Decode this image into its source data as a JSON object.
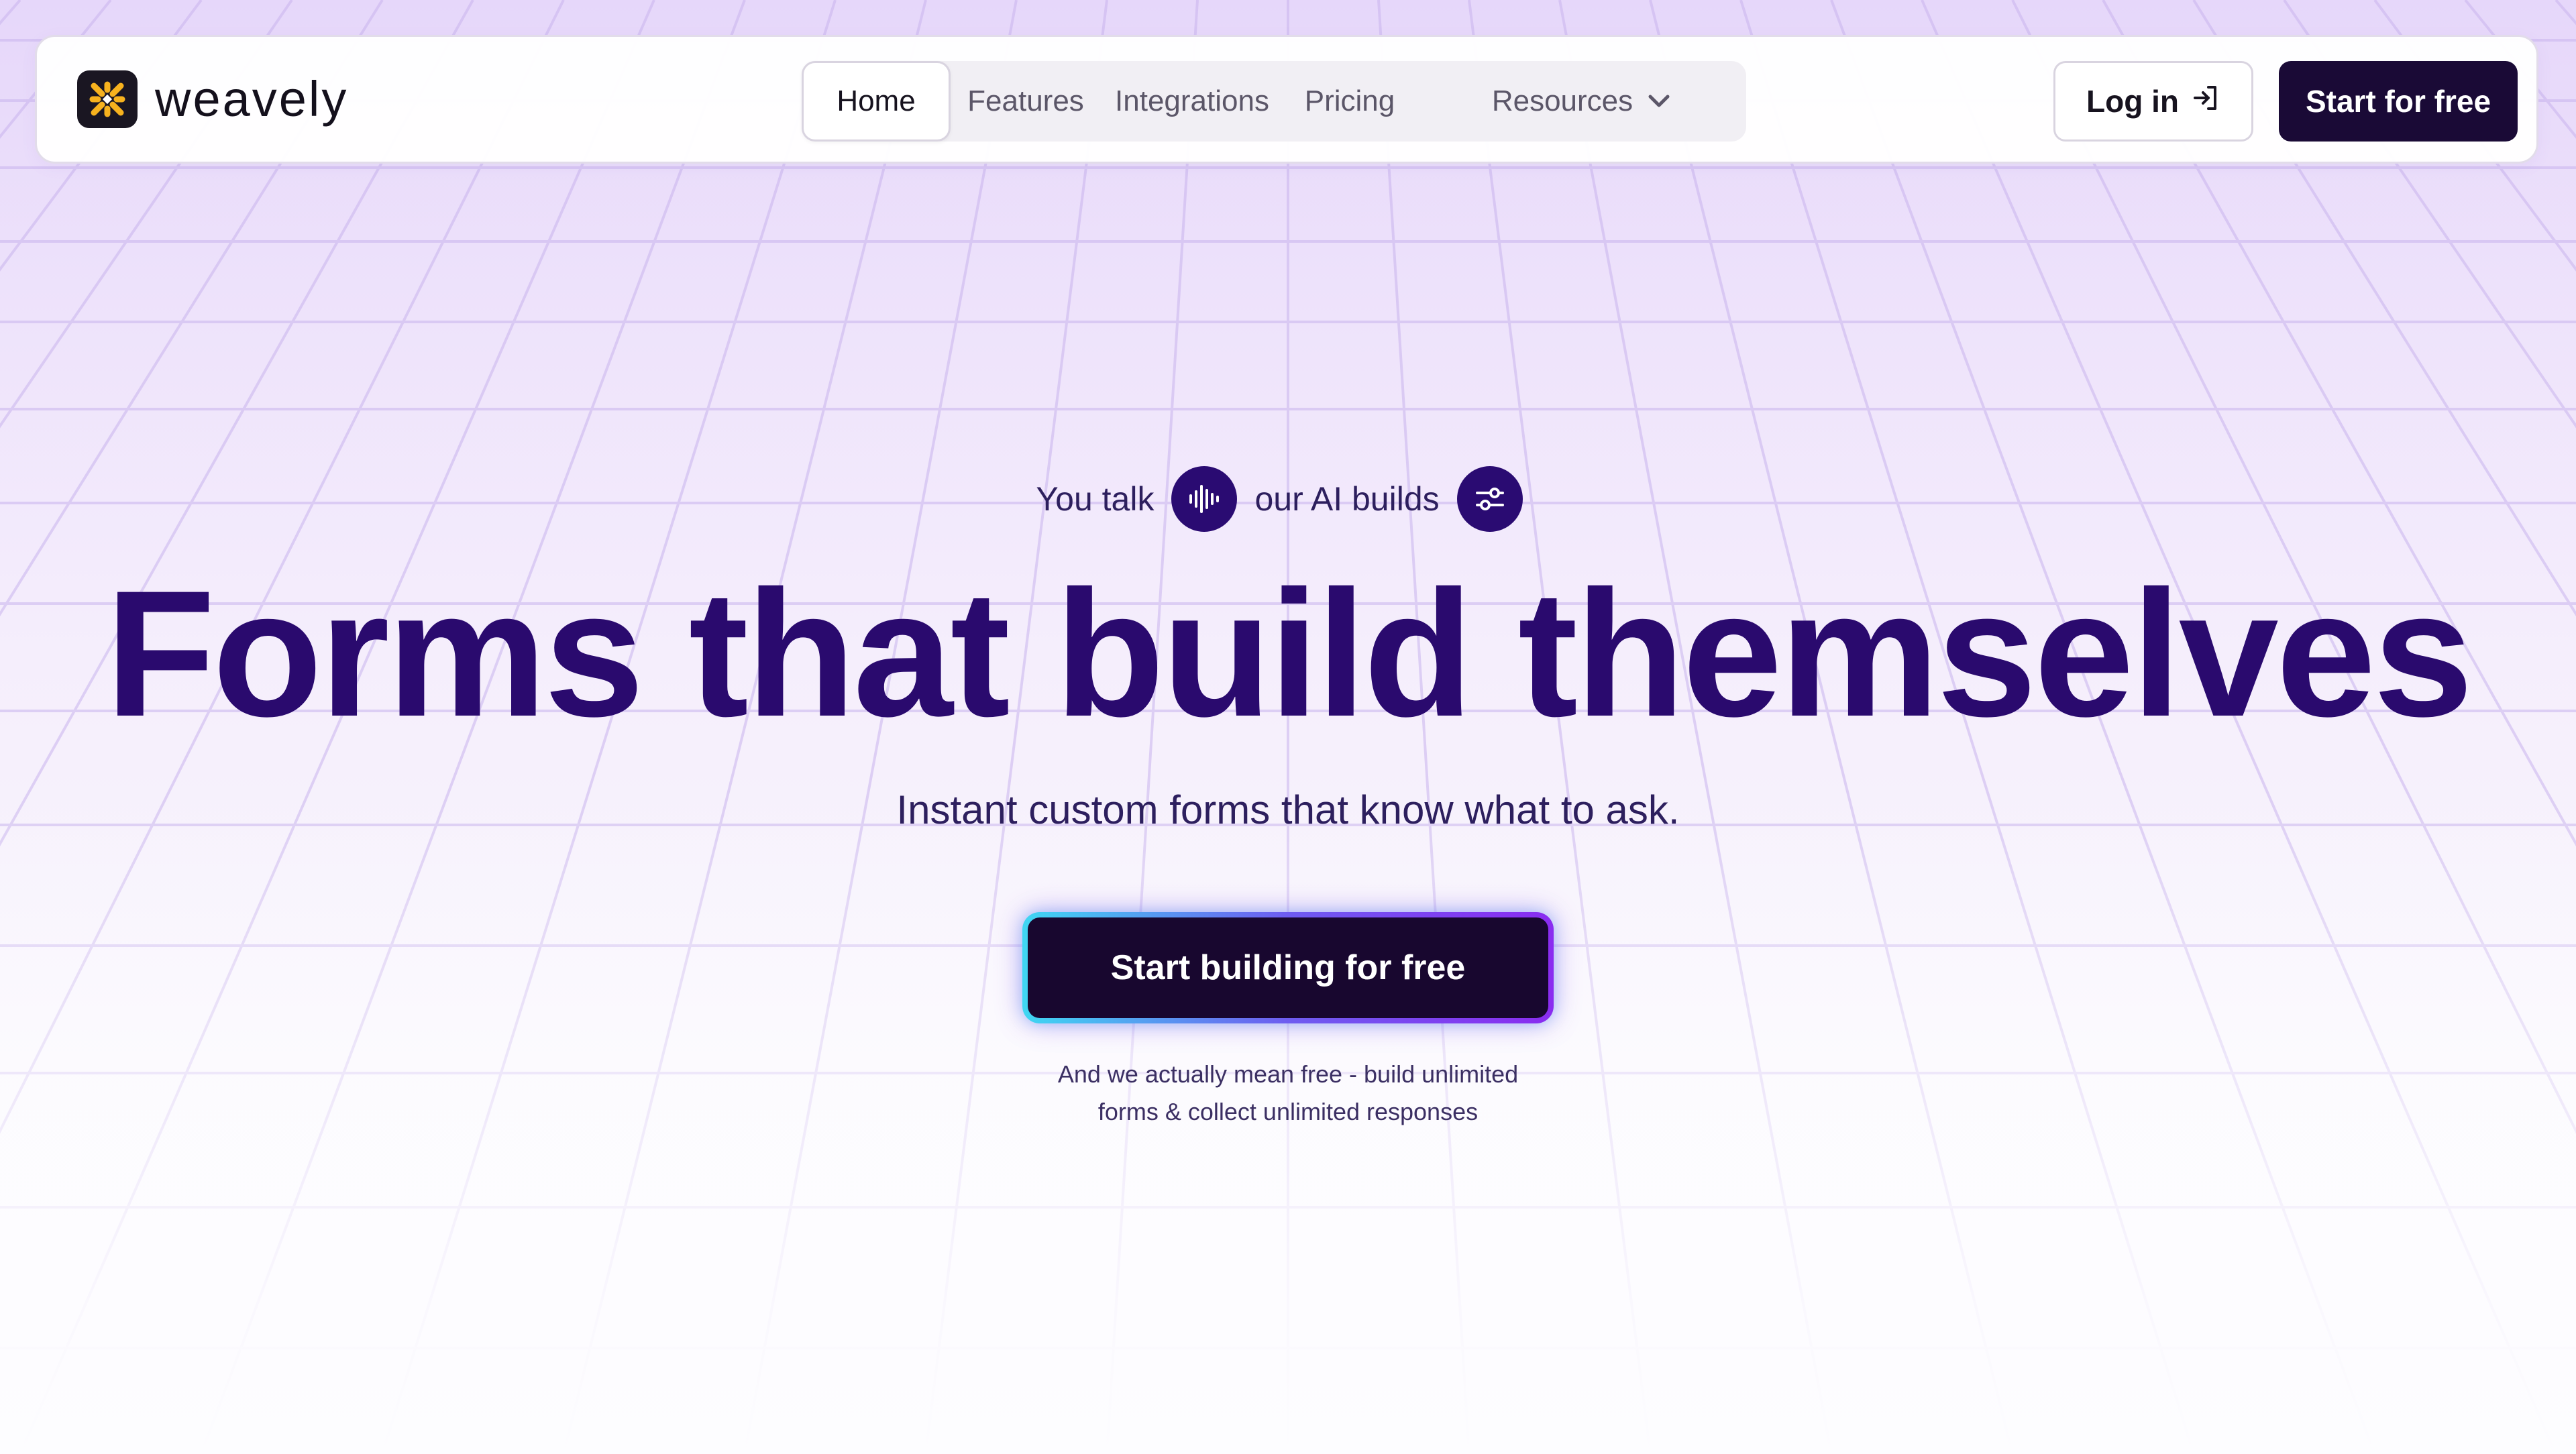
{
  "brand": {
    "name": "weavely",
    "logo_icon": "weavely-logo-icon",
    "logo_colors": [
      "#f7b21e",
      "#1a1622"
    ]
  },
  "nav": {
    "tabs": [
      {
        "label": "Home",
        "active": true
      },
      {
        "label": "Features",
        "active": false
      },
      {
        "label": "Integrations",
        "active": false
      },
      {
        "label": "Pricing",
        "active": false
      },
      {
        "label": "Resources",
        "active": false,
        "dropdown": true
      }
    ],
    "dropdown_icon": "chevron-down-icon"
  },
  "header_actions": {
    "login_label": "Log in",
    "login_icon": "login-arrow-icon",
    "start_label": "Start for free"
  },
  "hero": {
    "tagline_part1": "You talk",
    "tagline_icon1": "voice-wave-icon",
    "tagline_part2": "our AI builds",
    "tagline_icon2": "sliders-icon",
    "headline": "Forms that build themselves",
    "subhead": "Instant custom forms that know what to ask.",
    "cta_label": "Start building for free",
    "footnote_line1": "And we actually mean free - build unlimited",
    "footnote_line2": "forms & collect unlimited responses"
  },
  "colors": {
    "accent_dark": "#1a0a36",
    "headline": "#2a0a6e",
    "cta_glow_start": "#3fd7f2",
    "cta_glow_end": "#8a2cf0"
  }
}
